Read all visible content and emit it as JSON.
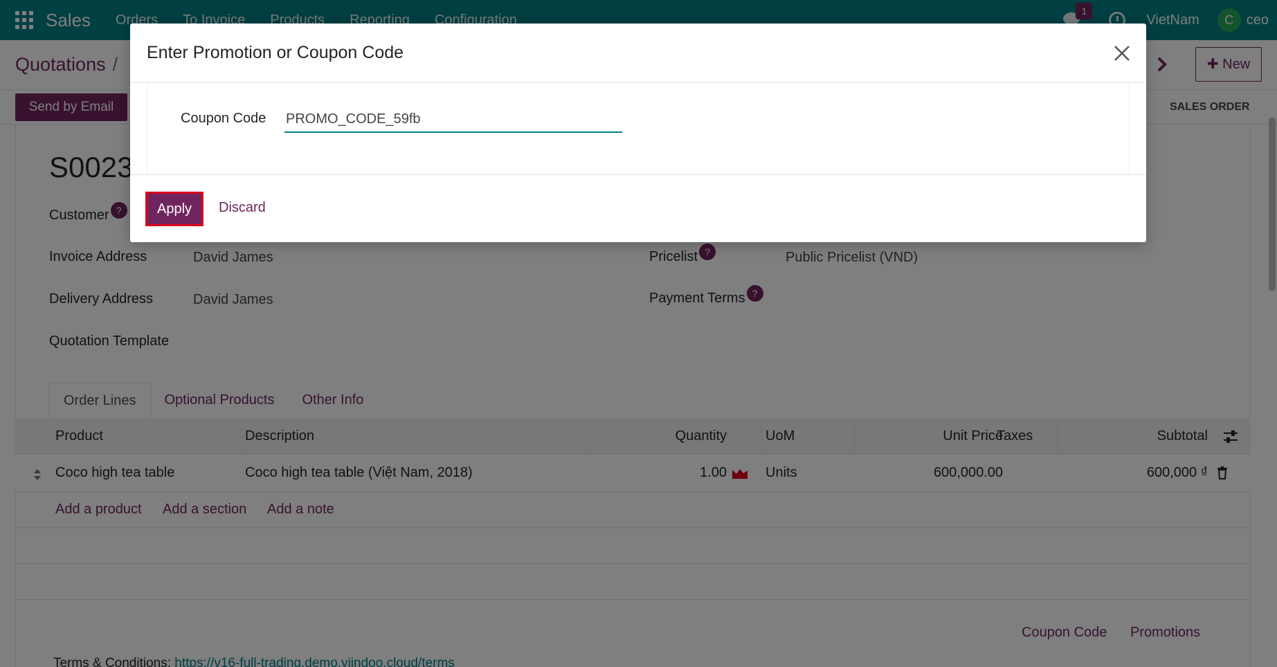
{
  "navbar": {
    "app_name": "Sales",
    "menu": [
      "Orders",
      "To Invoice",
      "Products",
      "Reporting",
      "Configuration"
    ],
    "chat_count": "1",
    "company": "VietNam",
    "avatar_letter": "C",
    "user": "ceo"
  },
  "control": {
    "breadcrumb_root": "Quotations",
    "breadcrumb_sep": "/",
    "new_label": "New",
    "send_email_label": "Send by Email",
    "stage_label": "SALES ORDER"
  },
  "form": {
    "order_name": "S0023",
    "customer_label": "Customer",
    "invoice_address_label": "Invoice Address",
    "invoice_address_value": "David James",
    "delivery_address_label": "Delivery Address",
    "delivery_address_value": "David James",
    "quotation_template_label": "Quotation Template",
    "pricelist_label": "Pricelist",
    "pricelist_value": "Public Pricelist (VND)",
    "payment_terms_label": "Payment Terms",
    "help_glyph": "?"
  },
  "tabs": [
    "Order Lines",
    "Optional Products",
    "Other Info"
  ],
  "table": {
    "headers": {
      "product": "Product",
      "description": "Description",
      "quantity": "Quantity",
      "uom": "UoM",
      "unit_price": "Unit Price",
      "taxes": "Taxes",
      "subtotal": "Subtotal"
    },
    "rows": [
      {
        "product": "Coco high tea table",
        "description": "Coco high tea table (Việt Nam, 2018)",
        "quantity": "1.00",
        "uom": "Units",
        "unit_price": "600,000.00",
        "subtotal": "600,000 ₫"
      }
    ],
    "add_product": "Add a product",
    "add_section": "Add a section",
    "add_note": "Add a note"
  },
  "footer_links": {
    "coupon_code": "Coupon Code",
    "promotions": "Promotions"
  },
  "terms": {
    "label": "Terms & Conditions:",
    "url": "https://v16-full-trading.demo.viindoo.cloud/terms"
  },
  "modal": {
    "title": "Enter Promotion or Coupon Code",
    "field_label": "Coupon Code",
    "field_value": "PROMO_CODE_59fb",
    "apply_label": "Apply",
    "discard_label": "Discard"
  },
  "colors": {
    "navbar": "#017e84",
    "primary": "#71255e",
    "highlight_border": "#e0001a"
  }
}
